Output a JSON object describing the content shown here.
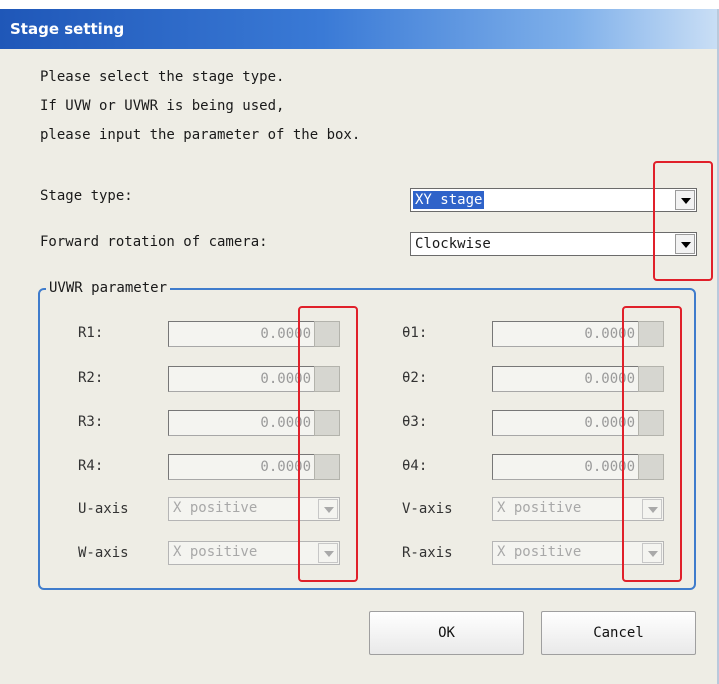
{
  "window": {
    "title": "Stage setting"
  },
  "intro": {
    "line1": "Please select the stage type.",
    "line2": "If UVW or UVWR is being used,",
    "line3": "please input the parameter of the box."
  },
  "stage_type": {
    "label": "Stage type:",
    "value": "XY stage"
  },
  "rotation": {
    "label": "Forward rotation of camera:",
    "value": "Clockwise"
  },
  "uvwr": {
    "group_label": "UVWR parameter",
    "left_rows": [
      {
        "label": "R1:",
        "value": "0.0000"
      },
      {
        "label": "R2:",
        "value": "0.0000"
      },
      {
        "label": "R3:",
        "value": "0.0000"
      },
      {
        "label": "R4:",
        "value": "0.0000"
      }
    ],
    "right_rows": [
      {
        "label": "θ1:",
        "value": "0.0000"
      },
      {
        "label": "θ2:",
        "value": "0.0000"
      },
      {
        "label": "θ3:",
        "value": "0.0000"
      },
      {
        "label": "θ4:",
        "value": "0.0000"
      }
    ],
    "axes": [
      {
        "label": "U-axis",
        "value": "X positive"
      },
      {
        "label": "W-axis",
        "value": "X positive"
      },
      {
        "label": "V-axis",
        "value": "X positive"
      },
      {
        "label": "R-axis",
        "value": "X positive"
      }
    ]
  },
  "buttons": {
    "ok": "OK",
    "cancel": "Cancel"
  },
  "colors": {
    "title_bar": "#1f57b8",
    "highlight_box": "#e0202a",
    "group_border": "#3f7ccc",
    "selection": "#2f63c9"
  }
}
